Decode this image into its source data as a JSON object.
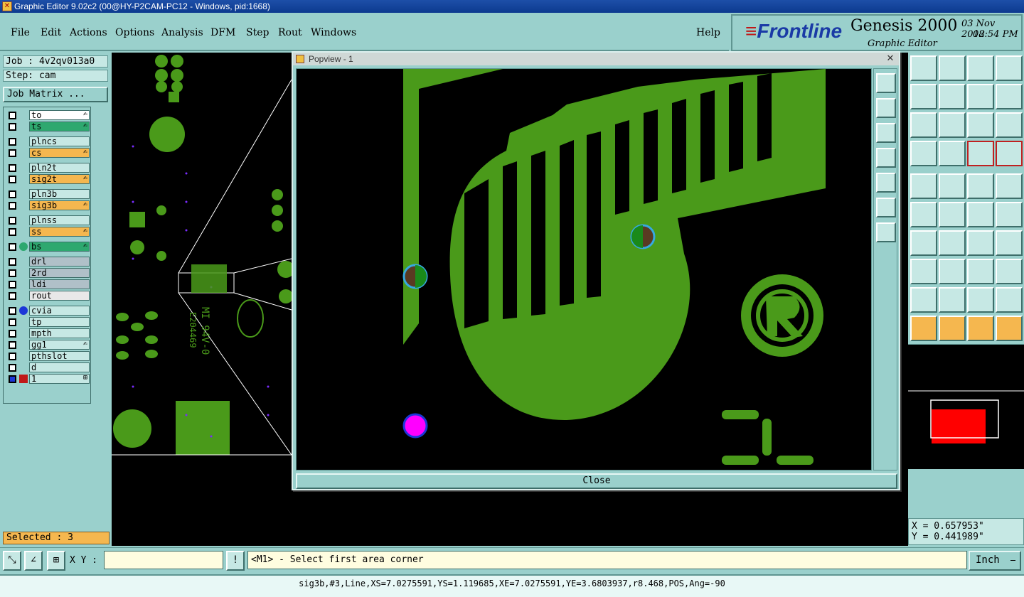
{
  "window": {
    "title": "Graphic Editor 9.02c2 (00@HY-P2CAM-PC12 - Windows, pid:1668)"
  },
  "menu": {
    "file": "File",
    "edit": "Edit",
    "actions": "Actions",
    "options": "Options",
    "analysis": "Analysis",
    "dfm": "DFM",
    "step": "Step",
    "rout": "Rout",
    "windows": "Windows",
    "help": "Help"
  },
  "brand": {
    "logo": "Frontline",
    "product": "Genesis 2000",
    "subtitle": "Graphic Editor",
    "date": "03 Nov 2012",
    "time": "08:54 PM"
  },
  "job": {
    "job_text": "Job : 4v2qv013a0",
    "step_text": "Step: cam",
    "matrix_button": "Job Matrix ..."
  },
  "layers": [
    {
      "name": "to",
      "color": "#ffffff",
      "mark": "✍"
    },
    {
      "name": "ts",
      "color": "#2ea86f",
      "mark": "✍"
    },
    {
      "name": "plncs",
      "color": "#c6e8e4",
      "mark": ""
    },
    {
      "name": "cs",
      "color": "#f5b74f",
      "mark": "✍"
    },
    {
      "name": "pln2t",
      "color": "#c6e8e4",
      "mark": ""
    },
    {
      "name": "sig2t",
      "color": "#f5b74f",
      "mark": "✍"
    },
    {
      "name": "pln3b",
      "color": "#c6e8e4",
      "mark": ""
    },
    {
      "name": "sig3b",
      "color": "#f5b74f",
      "mark": "✍"
    },
    {
      "name": "plnss",
      "color": "#c6e8e4",
      "mark": ""
    },
    {
      "name": "ss",
      "color": "#f5b74f",
      "mark": "✍"
    },
    {
      "name": "bs",
      "color": "#2ea86f",
      "mark": "✍"
    },
    {
      "name": "drl",
      "color": "#b0c0c8",
      "mark": ""
    },
    {
      "name": "2rd",
      "color": "#b0c0c8",
      "mark": ""
    },
    {
      "name": "ldi",
      "color": "#b0c0c8",
      "mark": ""
    },
    {
      "name": "rout",
      "color": "#e8e8e8",
      "mark": ""
    },
    {
      "name": "cvia",
      "color": "#c6e8e4",
      "mark": ""
    },
    {
      "name": "tp",
      "color": "#c6e8e4",
      "mark": ""
    },
    {
      "name": "mpth",
      "color": "#c6e8e4",
      "mark": ""
    },
    {
      "name": "gg1",
      "color": "#c6e8e4",
      "mark": "✍"
    },
    {
      "name": "pthslot",
      "color": "#c6e8e4",
      "mark": ""
    },
    {
      "name": "d",
      "color": "#c6e8e4",
      "mark": ""
    },
    {
      "name": "1",
      "color": "#c6e8e4",
      "mark": "⊞"
    }
  ],
  "selected_text": "Selected : 3",
  "popup": {
    "title": "Popview - 1",
    "close_x": "✕",
    "close_button": "Close"
  },
  "coords": {
    "x_text": "X = 0.657953\"",
    "y_text": "Y = 0.441989\""
  },
  "status": {
    "xy_label": "X Y :",
    "xy_value": "",
    "prompt": "<M1> - Select first area corner",
    "units": "Inch",
    "exclaim": "!"
  },
  "info_line": "sig3b,#3,Line,XS=7.0275591,YS=1.119685,XE=7.0275591,YE=3.6803937,r8.468,POS,Ang=-90",
  "colors": {
    "copper": "#4a9a1a",
    "via": "#ff00ff",
    "accent": "#f5b74f"
  }
}
